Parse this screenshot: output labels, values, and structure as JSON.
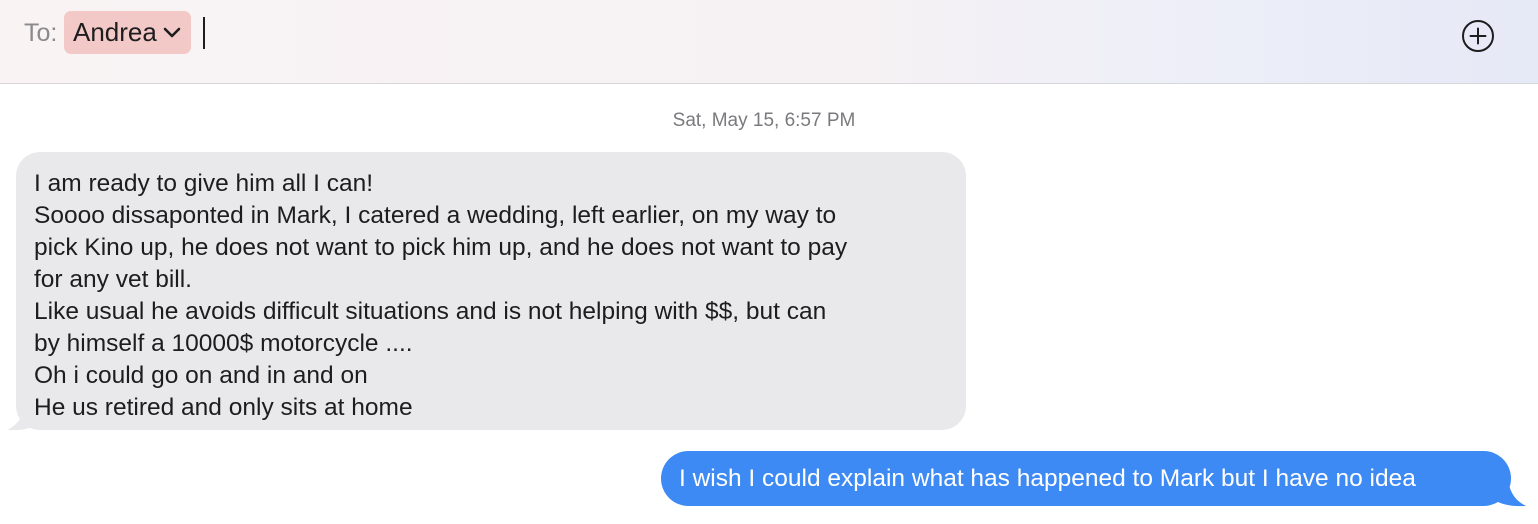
{
  "header": {
    "to_label": "To:",
    "recipient": "Andrea",
    "recipient_chip_color": "#f3c9c8",
    "add_icon": "plus-circle-icon"
  },
  "conversation": {
    "timestamp": "Sat, May 15, 6:57 PM",
    "incoming": {
      "bubble_color": "#e9e9eb",
      "lines": [
        "I am ready to give him all I can!",
        "Soooo dissaponted in Mark, I catered a wedding, left earlier, on my way to",
        "pick Kino up, he does not want to pick him up, and he does not want to pay",
        "for any vet bill.",
        "Like usual he avoids difficult situations and is not helping with $$, but can",
        "by himself a 10000$ motorcycle ....",
        "Oh i could go on and in and on",
        "He us retired and only sits at home"
      ]
    },
    "outgoing": {
      "bubble_color": "#3e8af4",
      "text": "I wish I could explain what has happened to Mark but I have no idea"
    }
  }
}
